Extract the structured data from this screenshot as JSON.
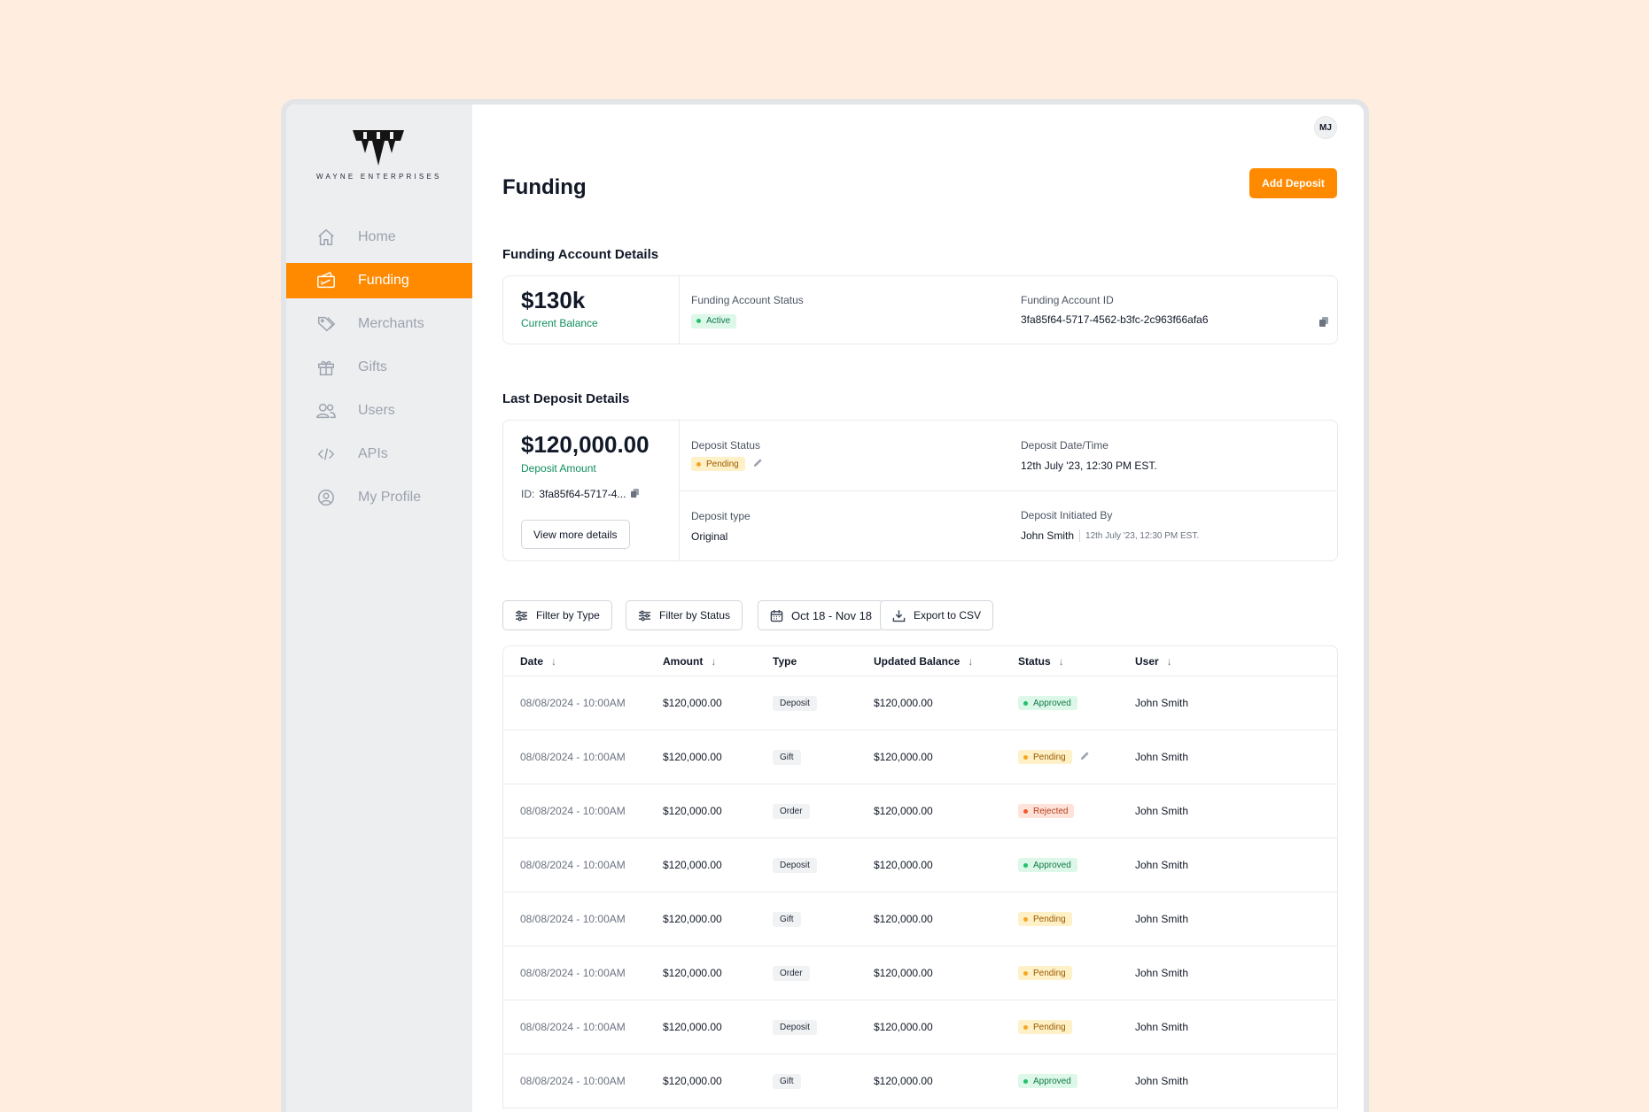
{
  "brand": {
    "logo_text": "WAYNE ENTERPRISES"
  },
  "user": {
    "initials": "MJ"
  },
  "sidebar": {
    "items": [
      {
        "label": "Home",
        "icon": "home-icon",
        "active": false
      },
      {
        "label": "Funding",
        "icon": "funding-icon",
        "active": true
      },
      {
        "label": "Merchants",
        "icon": "tag-icon",
        "active": false
      },
      {
        "label": "Gifts",
        "icon": "gift-icon",
        "active": false
      },
      {
        "label": "Users",
        "icon": "users-icon",
        "active": false
      },
      {
        "label": "APIs",
        "icon": "code-icon",
        "active": false
      },
      {
        "label": "My Profile",
        "icon": "profile-icon",
        "active": false
      }
    ]
  },
  "page": {
    "title": "Funding",
    "add_deposit_label": "Add Deposit"
  },
  "funding_account": {
    "section_title": "Funding Account Details",
    "balance": "$130k",
    "balance_label": "Current Balance",
    "status_label": "Funding Account Status",
    "status": "Active",
    "id_label": "Funding Account ID",
    "id": "3fa85f64-5717-4562-b3fc-2c963f66afa6"
  },
  "last_deposit": {
    "section_title": "Last Deposit Details",
    "amount": "$120,000.00",
    "amount_label": "Deposit Amount",
    "id_prefix": "ID:",
    "id": "3fa85f64-5717-4...",
    "view_more_label": "View more details",
    "status_label": "Deposit Status",
    "status": "Pending",
    "datetime_label": "Deposit Date/Time",
    "datetime": "12th July '23, 12:30 PM EST.",
    "type_label": "Deposit type",
    "type": "Original",
    "initiated_label": "Deposit Initiated By",
    "initiated_by": "John Smith",
    "initiated_at": "12th July '23, 12:30 PM EST."
  },
  "filters": {
    "filter_type": "Filter by Type",
    "filter_status": "Filter by Status",
    "date_range": "Oct 18 - Nov 18",
    "export": "Export to CSV"
  },
  "table": {
    "headers": [
      "Date",
      "Amount",
      "Type",
      "Updated Balance",
      "Status",
      "User"
    ],
    "sort_arrow": "↓",
    "rows": [
      {
        "date": "08/08/2024 - 10:00AM",
        "amount": "$120,000.00",
        "type": "Deposit",
        "balance": "$120,000.00",
        "status": "Approved",
        "user": "John Smith"
      },
      {
        "date": "08/08/2024 - 10:00AM",
        "amount": "$120,000.00",
        "type": "Gift",
        "balance": "$120,000.00",
        "status": "Pending",
        "user": "John Smith"
      },
      {
        "date": "08/08/2024 - 10:00AM",
        "amount": "$120,000.00",
        "type": "Order",
        "balance": "$120,000.00",
        "status": "Rejected",
        "user": "John Smith"
      },
      {
        "date": "08/08/2024 - 10:00AM",
        "amount": "$120,000.00",
        "type": "Deposit",
        "balance": "$120,000.00",
        "status": "Approved",
        "user": "John Smith"
      },
      {
        "date": "08/08/2024 - 10:00AM",
        "amount": "$120,000.00",
        "type": "Gift",
        "balance": "$120,000.00",
        "status": "Pending",
        "user": "John Smith"
      },
      {
        "date": "08/08/2024 - 10:00AM",
        "amount": "$120,000.00",
        "type": "Order",
        "balance": "$120,000.00",
        "status": "Pending",
        "user": "John Smith"
      },
      {
        "date": "08/08/2024 - 10:00AM",
        "amount": "$120,000.00",
        "type": "Deposit",
        "balance": "$120,000.00",
        "status": "Pending",
        "user": "John Smith"
      },
      {
        "date": "08/08/2024 - 10:00AM",
        "amount": "$120,000.00",
        "type": "Gift",
        "balance": "$120,000.00",
        "status": "Approved",
        "user": "John Smith"
      }
    ]
  },
  "colors": {
    "accent": "#FF8A00",
    "background": "#FFEDDF",
    "sidebar": "#EDEEF0",
    "approved": "#22C16B",
    "pending": "#F5A623",
    "rejected": "#EF5B2B"
  }
}
